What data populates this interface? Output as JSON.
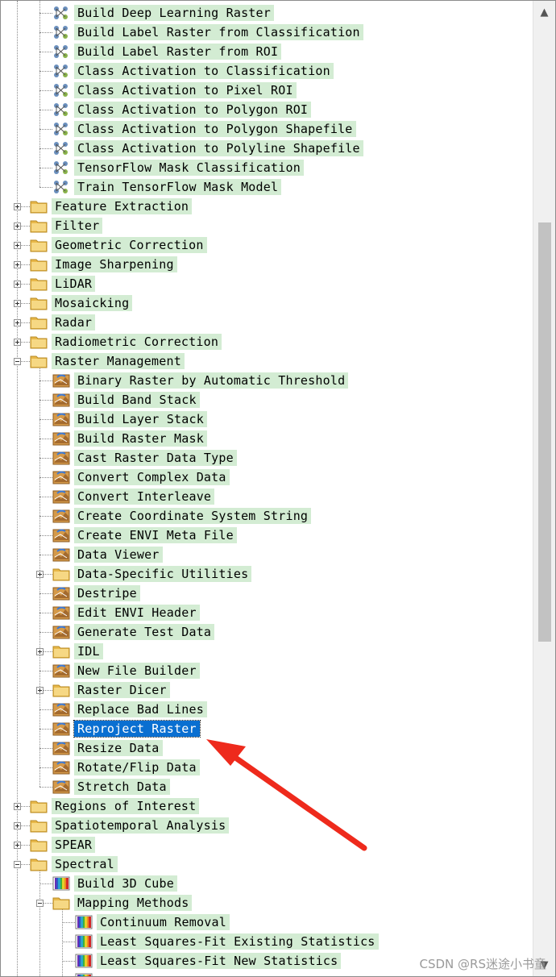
{
  "tree": {
    "nodes": [
      {
        "label": "Build Deep Learning Raster",
        "level": 2,
        "type": "tool-dl"
      },
      {
        "label": "Build Label Raster from Classification",
        "level": 2,
        "type": "tool-dl"
      },
      {
        "label": "Build Label Raster from ROI",
        "level": 2,
        "type": "tool-dl"
      },
      {
        "label": "Class Activation to Classification",
        "level": 2,
        "type": "tool-dl"
      },
      {
        "label": "Class Activation to Pixel ROI",
        "level": 2,
        "type": "tool-dl"
      },
      {
        "label": "Class Activation to Polygon ROI",
        "level": 2,
        "type": "tool-dl"
      },
      {
        "label": "Class Activation to Polygon Shapefile",
        "level": 2,
        "type": "tool-dl"
      },
      {
        "label": "Class Activation to Polyline Shapefile",
        "level": 2,
        "type": "tool-dl"
      },
      {
        "label": "TensorFlow Mask Classification",
        "level": 2,
        "type": "tool-dl"
      },
      {
        "label": "Train TensorFlow Mask Model",
        "level": 2,
        "type": "tool-dl",
        "last": true
      },
      {
        "label": "Feature Extraction",
        "level": 1,
        "type": "folder",
        "expander": "plus"
      },
      {
        "label": "Filter",
        "level": 1,
        "type": "folder",
        "expander": "plus"
      },
      {
        "label": "Geometric Correction",
        "level": 1,
        "type": "folder",
        "expander": "plus"
      },
      {
        "label": "Image Sharpening",
        "level": 1,
        "type": "folder",
        "expander": "plus"
      },
      {
        "label": "LiDAR",
        "level": 1,
        "type": "folder",
        "expander": "plus"
      },
      {
        "label": "Mosaicking",
        "level": 1,
        "type": "folder",
        "expander": "plus"
      },
      {
        "label": "Radar",
        "level": 1,
        "type": "folder",
        "expander": "plus"
      },
      {
        "label": "Radiometric Correction",
        "level": 1,
        "type": "folder",
        "expander": "plus"
      },
      {
        "label": "Raster Management",
        "level": 1,
        "type": "folder-open",
        "expander": "minus"
      },
      {
        "label": "Binary Raster by Automatic Threshold",
        "level": 2,
        "type": "tool"
      },
      {
        "label": "Build Band Stack",
        "level": 2,
        "type": "tool"
      },
      {
        "label": "Build Layer Stack",
        "level": 2,
        "type": "tool"
      },
      {
        "label": "Build Raster Mask",
        "level": 2,
        "type": "tool"
      },
      {
        "label": "Cast Raster Data Type",
        "level": 2,
        "type": "tool"
      },
      {
        "label": "Convert Complex Data",
        "level": 2,
        "type": "tool"
      },
      {
        "label": "Convert Interleave",
        "level": 2,
        "type": "tool"
      },
      {
        "label": "Create Coordinate System String",
        "level": 2,
        "type": "tool"
      },
      {
        "label": "Create ENVI Meta File",
        "level": 2,
        "type": "tool"
      },
      {
        "label": "Data Viewer",
        "level": 2,
        "type": "tool"
      },
      {
        "label": "Data-Specific Utilities",
        "level": 2,
        "type": "folder",
        "expander": "plus"
      },
      {
        "label": "Destripe",
        "level": 2,
        "type": "tool"
      },
      {
        "label": "Edit ENVI Header",
        "level": 2,
        "type": "tool"
      },
      {
        "label": "Generate Test Data",
        "level": 2,
        "type": "tool"
      },
      {
        "label": "IDL",
        "level": 2,
        "type": "folder",
        "expander": "plus"
      },
      {
        "label": "New File Builder",
        "level": 2,
        "type": "tool"
      },
      {
        "label": "Raster Dicer",
        "level": 2,
        "type": "folder",
        "expander": "plus"
      },
      {
        "label": "Replace Bad Lines",
        "level": 2,
        "type": "tool"
      },
      {
        "label": "Reproject Raster",
        "level": 2,
        "type": "tool",
        "selected": true
      },
      {
        "label": "Resize Data",
        "level": 2,
        "type": "tool"
      },
      {
        "label": "Rotate/Flip Data",
        "level": 2,
        "type": "tool"
      },
      {
        "label": "Stretch Data",
        "level": 2,
        "type": "tool",
        "last": true
      },
      {
        "label": "Regions of Interest",
        "level": 1,
        "type": "folder",
        "expander": "plus"
      },
      {
        "label": "Spatiotemporal Analysis",
        "level": 1,
        "type": "folder",
        "expander": "plus"
      },
      {
        "label": "SPEAR",
        "level": 1,
        "type": "folder",
        "expander": "plus"
      },
      {
        "label": "Spectral",
        "level": 1,
        "type": "folder-open",
        "expander": "minus"
      },
      {
        "label": "Build 3D Cube",
        "level": 2,
        "type": "spectral"
      },
      {
        "label": "Mapping Methods",
        "level": 2,
        "type": "folder-open",
        "expander": "minus"
      },
      {
        "label": "Continuum Removal",
        "level": 3,
        "type": "spectral"
      },
      {
        "label": "Least Squares-Fit Existing Statistics",
        "level": 3,
        "type": "spectral"
      },
      {
        "label": "Least Squares-Fit New Statistics",
        "level": 3,
        "type": "spectral"
      },
      {
        "label": "",
        "level": 3,
        "type": "spectral"
      }
    ]
  },
  "scrollbar": {
    "up_icon": "▲",
    "down_icon": "▼"
  },
  "watermark": "CSDN @RS迷途小书童",
  "colors": {
    "label_bg": "#d3ecd3",
    "selected_bg": "#0a6fd1",
    "arrow": "#ee2a1c"
  }
}
